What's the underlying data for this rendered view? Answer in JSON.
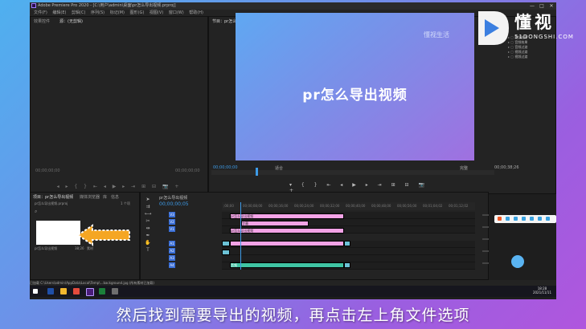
{
  "window": {
    "title": "Adobe Premiere Pro 2020 - [C:\\用户\\admin\\桌面\\pr怎么导出视频.prproj]",
    "controls": [
      "—",
      "□",
      "✕"
    ]
  },
  "menu": [
    "文件(F)",
    "编辑(E)",
    "剪辑(C)",
    "序列(S)",
    "标记(M)",
    "图形(G)",
    "视图(V)",
    "窗口(W)",
    "帮助(H)"
  ],
  "source_panel": {
    "tabs": [
      "效果控件",
      "源：(无剪辑)"
    ],
    "timecode_left": "00;00;00;00",
    "timecode_right": "00;00;00;00",
    "controls": "◂ ▸ { } ⇤ ◂ ▶ ▸ ⇥ ⊞ ⊟ 📷 +"
  },
  "program_panel": {
    "tab": "节目：pr怎么导出视频",
    "video_text": "pr怎么导出视频",
    "timecode": "00;00;00;00",
    "fit": "适合",
    "quality": "完整",
    "duration": "00;00;38;26",
    "transport": "▾ { } ⇤ ◂ ▶ ▸ ⇥ ⊞ ⊟ 📷 +"
  },
  "effects_list": [
    "视频效果",
    "音频效果",
    "音频过渡",
    "视频过渡",
    "视频过渡"
  ],
  "project_panel": {
    "tabs": [
      "项目：pr怎么导出视频",
      "媒体浏览器",
      "库",
      "信息"
    ],
    "name": "pr怎么导出视频.prproj",
    "search_icon": "search-icon",
    "item_name": "pr怎么导出视频",
    "item_duration": "38;26",
    "item_type": "素材",
    "item_count": "1 个项"
  },
  "timeline": {
    "tab": "pr怎么导出视频",
    "timecode": "00;00;00;05",
    "ruler": [
      ";00;00",
      "00;00;08;00",
      "00;00;16;00",
      "00;00;24;00",
      "00;00;32;00",
      "00;00;40;00",
      "00;00;48;00",
      "00;00;56;00",
      "00;01;04;02",
      "00;01;12;02"
    ],
    "tracks": [
      {
        "label": "V3",
        "color": "#3a6fd8"
      },
      {
        "label": "V2",
        "color": "#3a6fd8"
      },
      {
        "label": "V1",
        "color": "#3a6fd8"
      },
      {
        "label": "A1",
        "color": "#3a6fd8"
      },
      {
        "label": "A2",
        "color": "#3a6fd8"
      },
      {
        "label": "A3",
        "color": "#3a6fd8"
      },
      {
        "label": "A4",
        "color": "#3a6fd8"
      }
    ],
    "clips": {
      "c1": "pr怎么导出视频",
      "c2": "字幕",
      "c3": "pr怎么导出视频",
      "c4": "音频"
    }
  },
  "status": {
    "text": "已加载 C:\\Users\\admin\\AppData\\Local\\Temp\\...background.jpg (所有素材已加载)"
  },
  "taskbar": {
    "time": "18:28",
    "date": "2021/11/11"
  },
  "watermark": {
    "small": "懂视生活"
  },
  "logo": {
    "name": "懂视",
    "domain": "51DONGSHI.COM"
  },
  "subtitle": "然后找到需要导出的视频，再点击左上角文件选项"
}
